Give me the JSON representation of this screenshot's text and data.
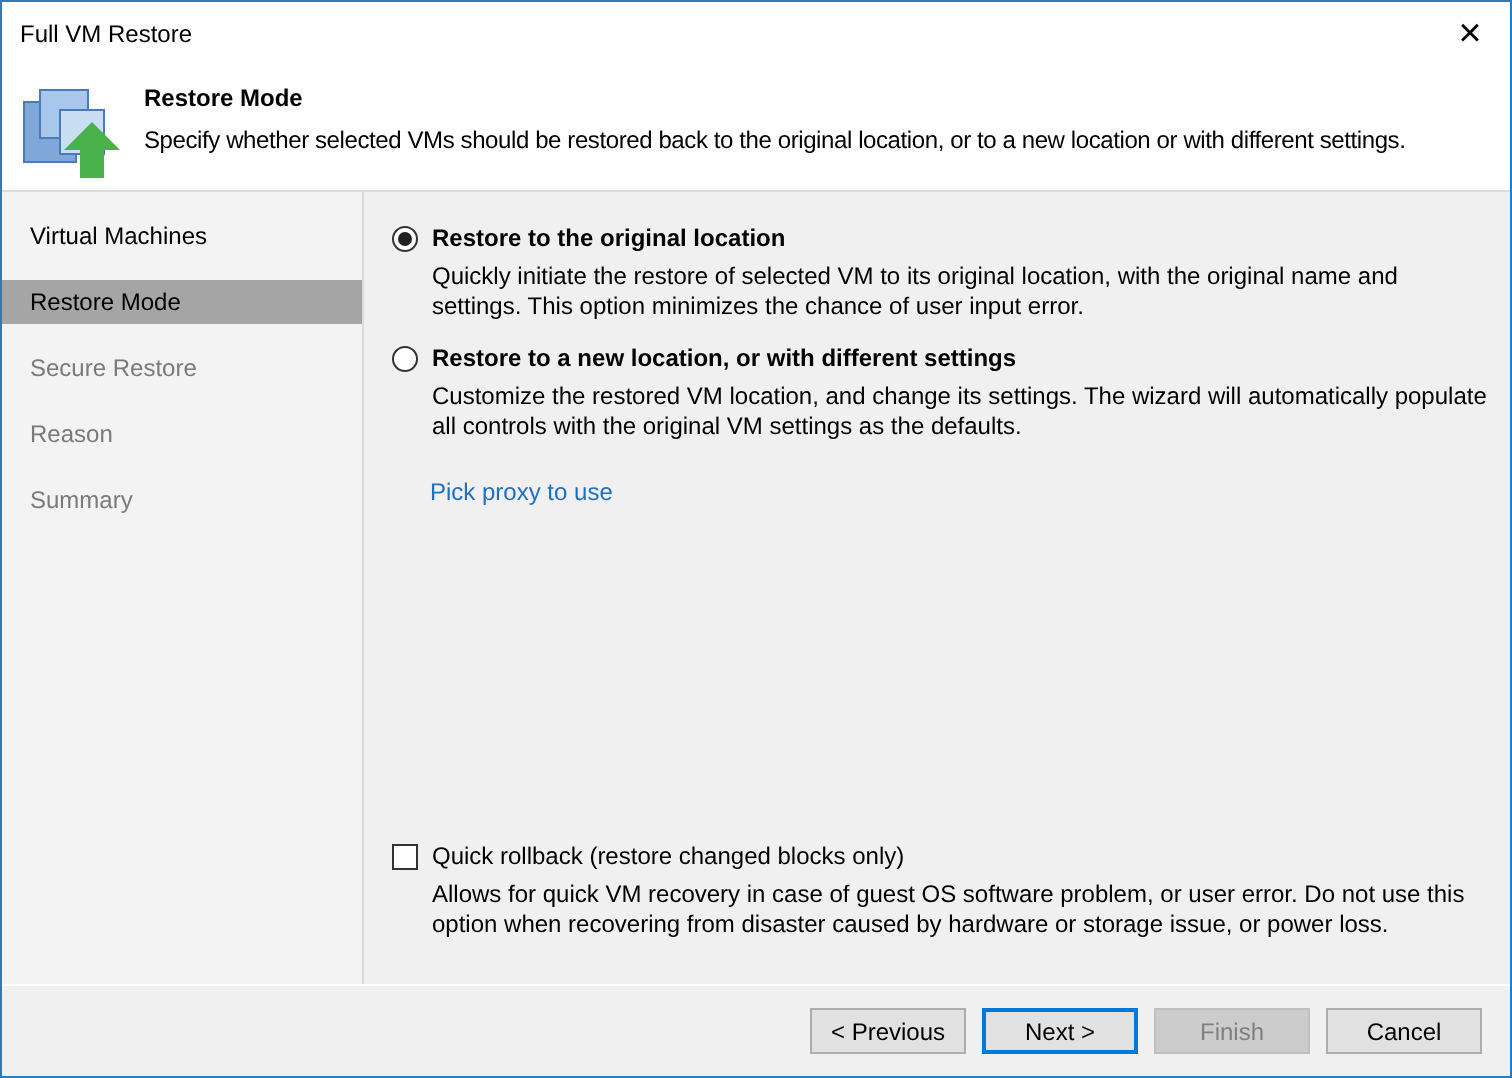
{
  "window": {
    "title": "Full VM Restore",
    "close": "×"
  },
  "header": {
    "title": "Restore Mode",
    "description": "Specify whether selected VMs should be restored back to the original location, or to a new location or with different settings."
  },
  "steps": [
    {
      "label": "Virtual Machines",
      "selected": false,
      "disabled": false
    },
    {
      "label": "Restore Mode",
      "selected": true,
      "disabled": false
    },
    {
      "label": "Secure Restore",
      "selected": false,
      "disabled": true
    },
    {
      "label": "Reason",
      "selected": false,
      "disabled": true
    },
    {
      "label": "Summary",
      "selected": false,
      "disabled": true
    }
  ],
  "options": [
    {
      "label": "Restore to the original location",
      "description": "Quickly initiate the restore of selected VM to its original location, with the original name and settings. This option minimizes the chance of user input error.",
      "selected": true
    },
    {
      "label": "Restore to a new location, or with different settings",
      "description": "Customize the restored VM location, and change its settings. The wizard will automatically populate all controls with the original VM settings as the defaults.",
      "selected": false
    }
  ],
  "link": "Pick proxy to use",
  "quick_rollback": {
    "label": "Quick rollback (restore changed blocks only)",
    "checked": false,
    "description": "Allows for quick VM recovery in case of guest OS software problem, or user error. Do not use this option when recovering from disaster caused by hardware or storage issue, or power loss."
  },
  "buttons": [
    {
      "label": "< Previous",
      "default": false,
      "disabled": false
    },
    {
      "label": "Next >",
      "default": true,
      "disabled": false
    },
    {
      "label": "Finish",
      "default": false,
      "disabled": true
    },
    {
      "label": "Cancel",
      "default": false,
      "disabled": false
    }
  ]
}
